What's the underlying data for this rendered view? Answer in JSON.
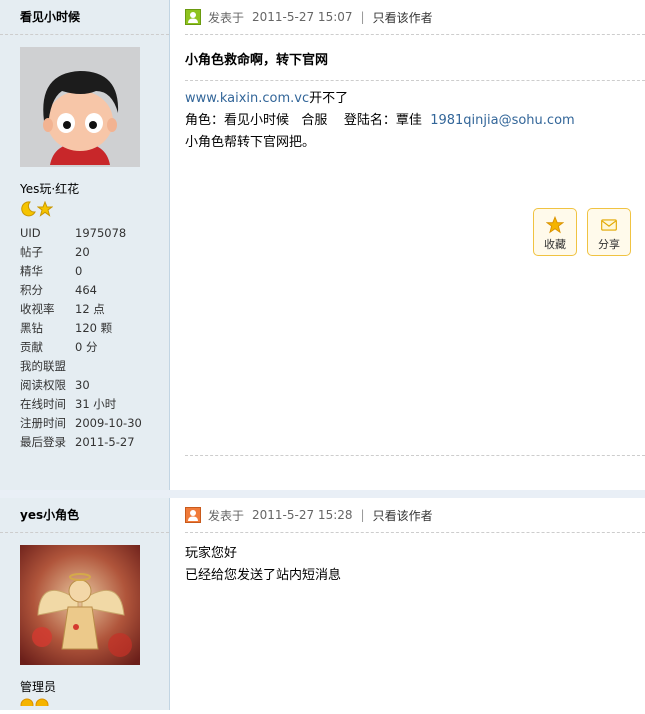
{
  "posts": [
    {
      "username": "看见小时候",
      "user_title": "Yes玩·红花",
      "stats": [
        {
          "key": "UID",
          "value": "1975078"
        },
        {
          "key": "帖子",
          "value": "20"
        },
        {
          "key": "精华",
          "value": "0"
        },
        {
          "key": "积分",
          "value": "464"
        },
        {
          "key": "收视率",
          "value": "12 点"
        },
        {
          "key": "黑钻",
          "value": "120 颗"
        },
        {
          "key": "贡献",
          "value": "0 分"
        },
        {
          "key": "我的联盟",
          "value": ""
        },
        {
          "key": "阅读权限",
          "value": "30"
        },
        {
          "key": "在线时间",
          "value": "31 小时"
        },
        {
          "key": "注册时间",
          "value": "2009-10-30"
        },
        {
          "key": "最后登录",
          "value": "2011-5-27"
        }
      ],
      "posted_label": "发表于",
      "posted_time": "2011-5-27 15:07",
      "separator": "|",
      "author_only_label": "只看该作者",
      "status_color": "#8fc31f",
      "title": "小角色救命啊，转下官网",
      "content": {
        "line1_link": "www.kaixin.com.vc",
        "line1_text": "开不了",
        "line2_text": "角色：看见小时候   合服    登陆名：覃佳  ",
        "line2_email": "1981qinjia@sohu.com",
        "line3_text": "小角色帮转下官网把。"
      },
      "actions": {
        "favorite_label": "收藏",
        "share_label": "分享"
      }
    },
    {
      "username": "yes小角色",
      "group_title": "管理员",
      "posted_label": "发表于",
      "posted_time": "2011-5-27 15:28",
      "separator": "|",
      "author_only_label": "只看该作者",
      "status_color": "#f07b3a",
      "content": {
        "line1_text": "玩家您好",
        "line2_text": "已经给您发送了站内短消息"
      }
    }
  ],
  "colors": {
    "sidebar_bg": "#e5edf2",
    "link": "#336699",
    "button_border": "#f0c342"
  }
}
